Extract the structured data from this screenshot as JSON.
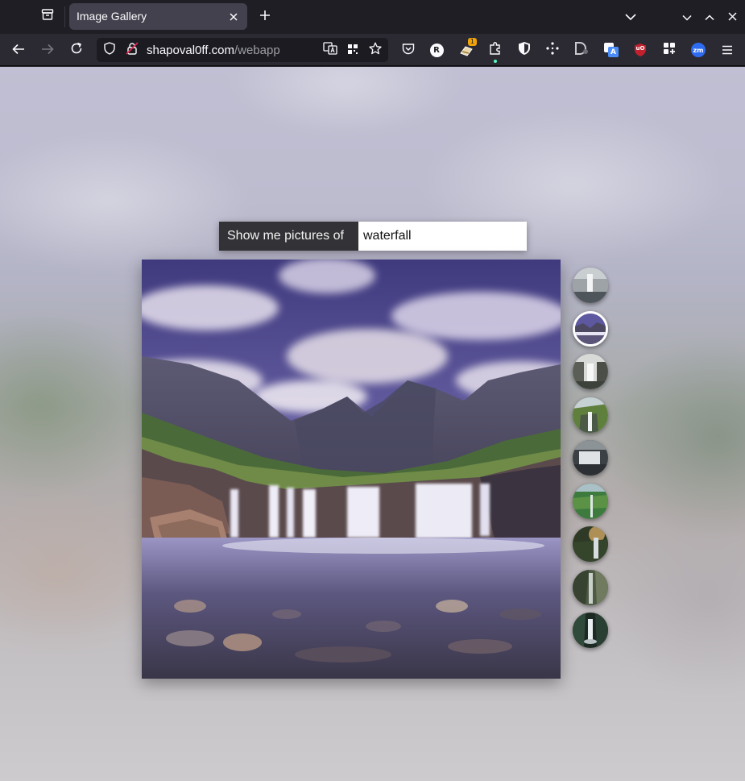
{
  "browser": {
    "tab": {
      "title": "Image Gallery"
    },
    "url": {
      "host": "shapoval0ff.com",
      "path": "/webapp"
    },
    "extensions": [
      {
        "icon": "pocket-icon"
      },
      {
        "icon": "r-extension-icon",
        "text": "R"
      },
      {
        "icon": "notification-extension-icon",
        "badge": "1"
      },
      {
        "icon": "puzzle-extensions-icon"
      },
      {
        "icon": "shield-extension-icon"
      },
      {
        "icon": "dots-extension-icon"
      },
      {
        "icon": "d-extension-icon"
      },
      {
        "icon": "translate-extension-icon",
        "text": "A"
      },
      {
        "icon": "ublock-origin-icon",
        "text": "uO"
      },
      {
        "icon": "apps-grid-icon"
      },
      {
        "icon": "zoom-extension-icon",
        "text": "zm"
      }
    ]
  },
  "gallery": {
    "search_label": "Show me pictures of",
    "search_value": "waterfall",
    "active_thumbnail": 1,
    "thumbnails": [
      {
        "name": "thumbnail-waterfall-grey-cliffs"
      },
      {
        "name": "thumbnail-fairy-pools-mountains"
      },
      {
        "name": "thumbnail-waterfall-misty-gorge"
      },
      {
        "name": "thumbnail-waterfall-green-valley"
      },
      {
        "name": "thumbnail-waterfall-dark-cave"
      },
      {
        "name": "thumbnail-waterfall-green-cliffs"
      },
      {
        "name": "thumbnail-waterfall-sunset-forest"
      },
      {
        "name": "thumbnail-waterfall-mossy-rocks"
      },
      {
        "name": "thumbnail-waterfall-dark-canyon"
      }
    ]
  },
  "colors": {
    "accent_badge": "#f0a30a",
    "ublock_red": "#c3202e",
    "zoom_blue": "#2d6cf0",
    "translate_blue": "#4a8df8"
  }
}
